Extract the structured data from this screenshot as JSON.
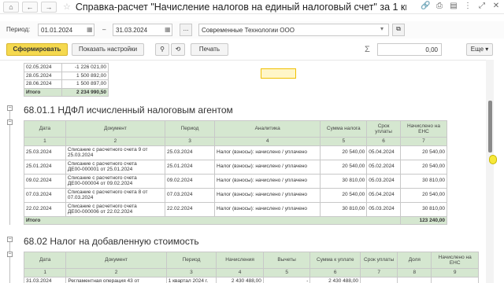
{
  "window": {
    "title": "Справка-расчет \"Начисление налогов на единый налоговый счет\" за 1 квар..."
  },
  "period": {
    "label": "Период:",
    "from": "01.01.2024",
    "dash": "–",
    "to": "31.03.2024",
    "dots": "...",
    "organization": "Современные Технологии ООО"
  },
  "toolbar": {
    "generate": "Сформировать",
    "show_settings": "Показать настройки",
    "print": "Печать",
    "sum_value": "0,00",
    "more": "Еще"
  },
  "top_rows": [
    {
      "date": "02.05.2024",
      "value": "-1 226 021,00"
    },
    {
      "date": "28.05.2024",
      "value": "1 500 892,00"
    },
    {
      "date": "28.06.2024",
      "value": "1 500 897,00"
    }
  ],
  "top_total": {
    "label": "Итого",
    "value": "2 234 990,50"
  },
  "section1": {
    "title": "68.01.1 НДФЛ исчисленный налоговым агентом",
    "headers": [
      "Дата",
      "Документ",
      "Период",
      "Аналитика",
      "Сумма налога",
      "Срок уплаты",
      "Начислено на ЕНС"
    ],
    "numbers": [
      "1",
      "2",
      "3",
      "4",
      "5",
      "6",
      "7"
    ],
    "rows": [
      {
        "date": "25.03.2024",
        "doc1": "Списание с расчетного счета 9 от",
        "doc2": "25.03.2024",
        "period": "25.03.2024",
        "analytics": "Налог (взносы): начислено / уплачено",
        "sum": "20 540,00",
        "due": "05.04.2024",
        "accrued": "20 540,00"
      },
      {
        "date": "25.01.2024",
        "doc1": "Списание с расчетного счета",
        "doc2": "ДЕ00-000001 от 25.01.2024",
        "period": "25.01.2024",
        "analytics": "Налог (взносы): начислено / уплачено",
        "sum": "20 540,00",
        "due": "05.02.2024",
        "accrued": "20 540,00"
      },
      {
        "date": "09.02.2024",
        "doc1": "Списание с расчетного счета",
        "doc2": "ДЕ00-000004 от 09.02.2024",
        "period": "09.02.2024",
        "analytics": "Налог (взносы): начислено / уплачено",
        "sum": "30 810,00",
        "due": "05.03.2024",
        "accrued": "30 810,00"
      },
      {
        "date": "07.03.2024",
        "doc1": "Списание с расчетного счета 8 от",
        "doc2": "07.03.2024",
        "period": "07.03.2024",
        "analytics": "Налог (взносы): начислено / уплачено",
        "sum": "20 540,00",
        "due": "05.04.2024",
        "accrued": "20 540,00"
      },
      {
        "date": "22.02.2024",
        "doc1": "Списание с расчетного счета",
        "doc2": "ДЕ00-000006 от 22.02.2024",
        "period": "22.02.2024",
        "analytics": "Налог (взносы): начислено / уплачено",
        "sum": "30 810,00",
        "due": "05.03.2024",
        "accrued": "30 810,00"
      }
    ],
    "total_label": "Итого",
    "total_value": "123 240,00"
  },
  "section2": {
    "title": "68.02 Налог на добавленную стоимость",
    "headers": [
      "Дата",
      "Документ",
      "Период",
      "Начисления",
      "Вычеты",
      "Сумма к уплате",
      "Срок уплаты",
      "Доля",
      "Начислено на ЕНС"
    ],
    "numbers": [
      "1",
      "2",
      "3",
      "4",
      "5",
      "6",
      "7",
      "8",
      "9"
    ],
    "rows": [
      {
        "date": "31.03.2024",
        "doc": "Регламентная операция 43 от",
        "period": "1 квартал 2024 г.",
        "accr": "2 430 488,00",
        "ded": "-",
        "pay": "2 430 488,00"
      }
    ]
  }
}
